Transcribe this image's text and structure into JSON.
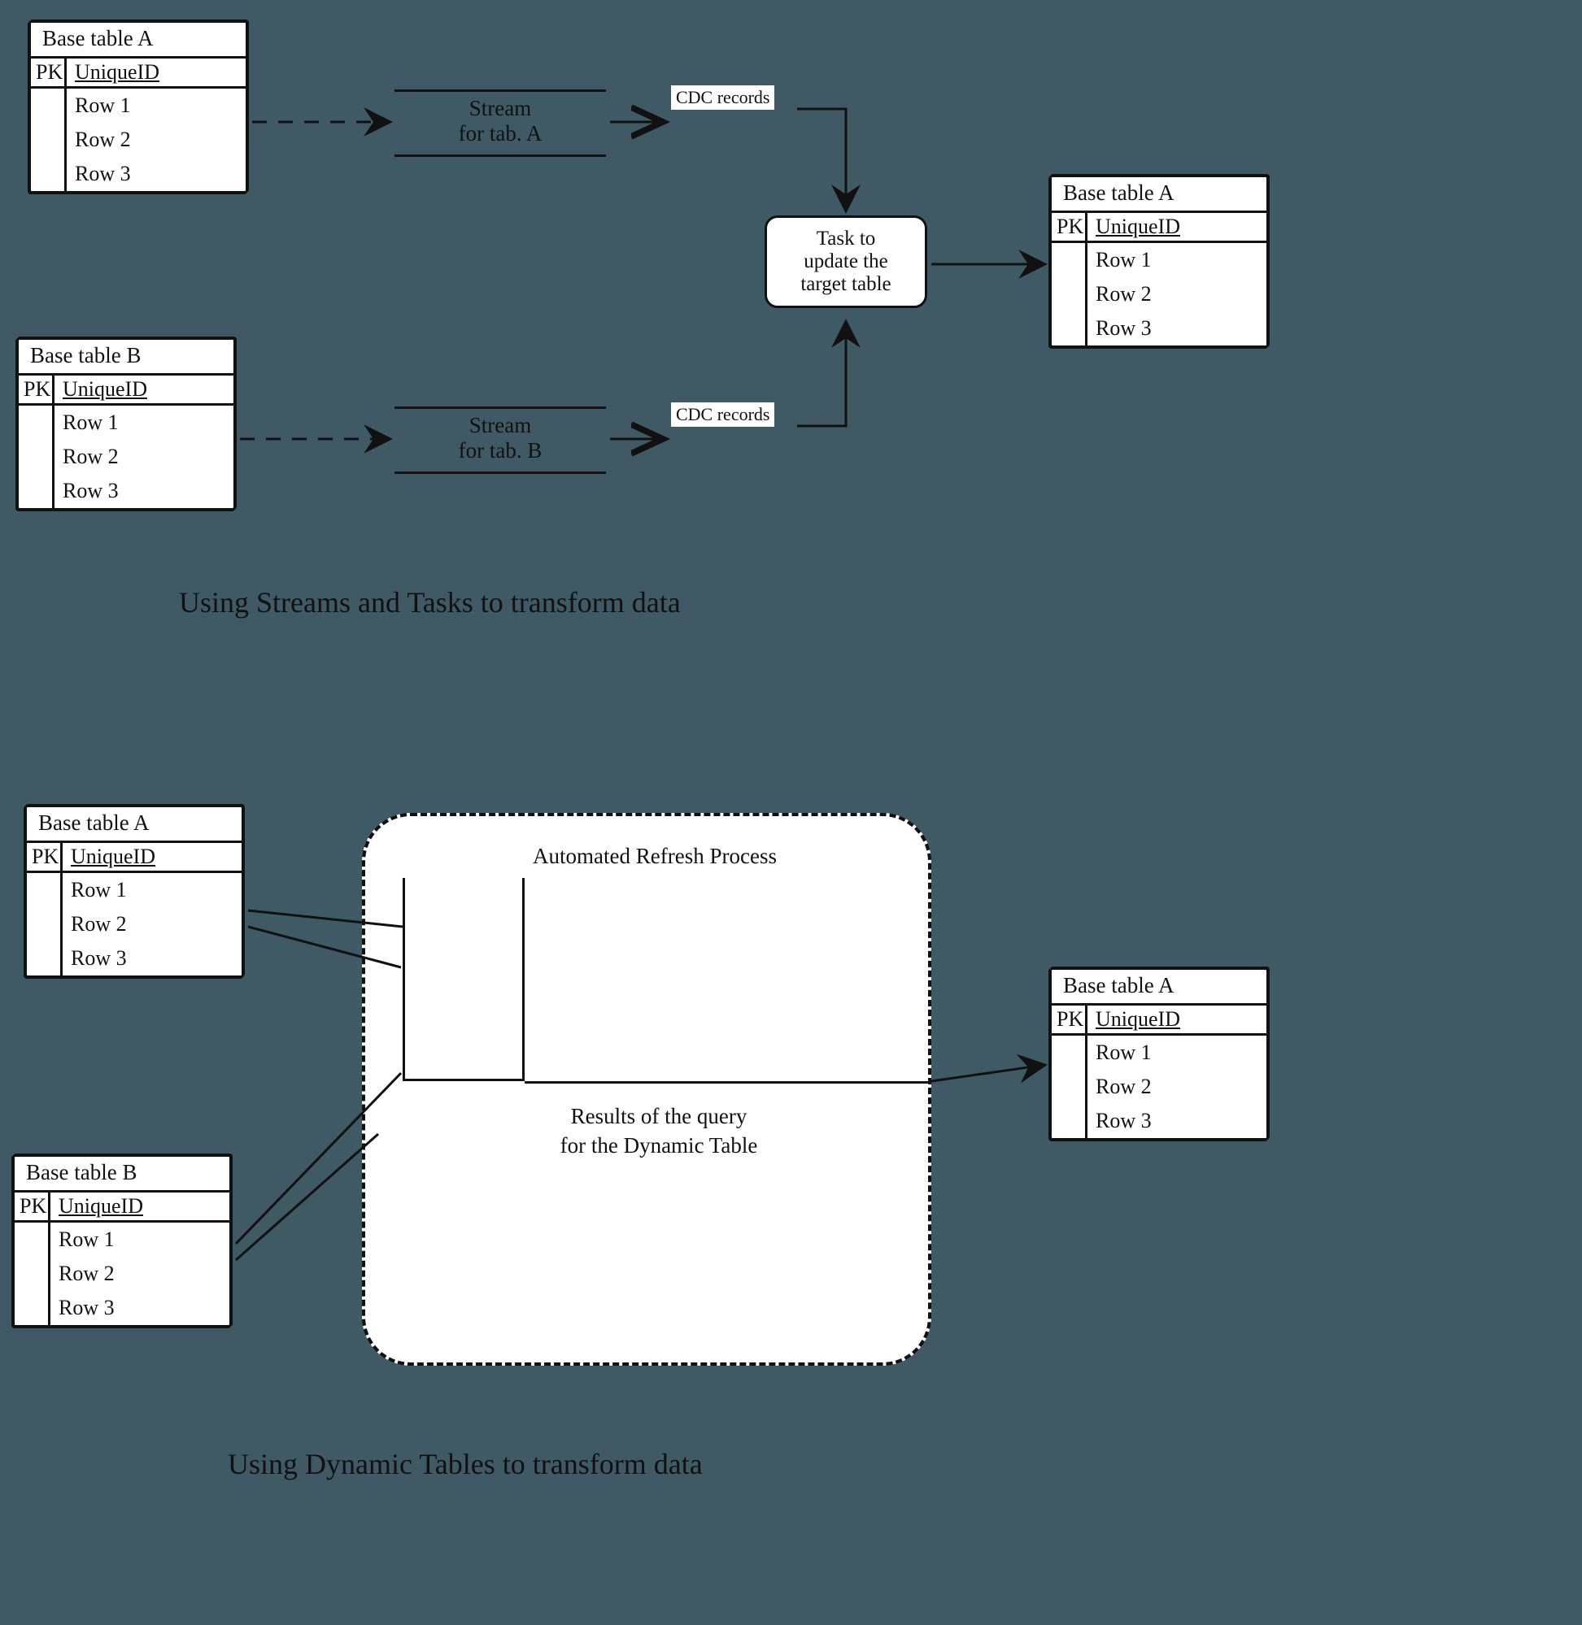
{
  "diagram1": {
    "caption": "Using Streams and Tasks to transform data",
    "tableA": {
      "title": "Base table A",
      "pk": "PK",
      "uid": "UniqueID",
      "rows": [
        "Row 1",
        "Row 2",
        "Row 3"
      ]
    },
    "tableB": {
      "title": "Base table B",
      "pk": "PK",
      "uid": "UniqueID",
      "rows": [
        "Row 1",
        "Row 2",
        "Row 3"
      ]
    },
    "tableOut": {
      "title": "Base table A",
      "pk": "PK",
      "uid": "UniqueID",
      "rows": [
        "Row 1",
        "Row 2",
        "Row 3"
      ]
    },
    "streamA": {
      "line1": "Stream",
      "line2": "for tab. A"
    },
    "streamB": {
      "line1": "Stream",
      "line2": "for tab. B"
    },
    "cdcA": "CDC records",
    "cdcB": "CDC records",
    "task": {
      "line1": "Task to",
      "line2": "update the",
      "line3": "target table"
    }
  },
  "diagram2": {
    "caption": "Using Dynamic Tables to transform data",
    "tableA": {
      "title": "Base table A",
      "pk": "PK",
      "uid": "UniqueID",
      "rows": [
        "Row 1",
        "Row 2",
        "Row 3"
      ]
    },
    "tableB": {
      "title": "Base table B",
      "pk": "PK",
      "uid": "UniqueID",
      "rows": [
        "Row 1",
        "Row 2",
        "Row 3"
      ]
    },
    "tableOut": {
      "title": "Base table A",
      "pk": "PK",
      "uid": "UniqueID",
      "rows": [
        "Row 1",
        "Row 2",
        "Row 3"
      ]
    },
    "refreshTitle": "Automated Refresh Process",
    "resultLabel": {
      "line1": "Results of the query",
      "line2": "for the Dynamic Table"
    }
  }
}
